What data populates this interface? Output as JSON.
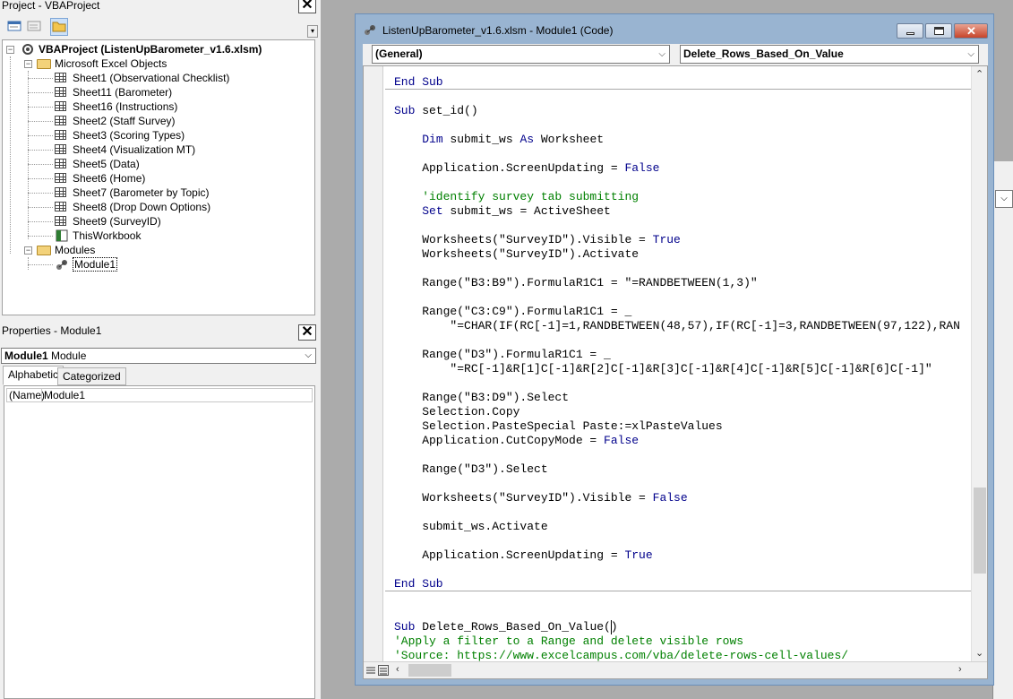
{
  "project_pane": {
    "title": "Project - VBAProject",
    "root": "VBAProject (ListenUpBarometer_v1.6.xlsm)",
    "folder_objects": "Microsoft Excel Objects",
    "sheets": [
      "Sheet1 (Observational Checklist)",
      "Sheet11 (Barometer)",
      "Sheet16 (Instructions)",
      "Sheet2 (Staff Survey)",
      "Sheet3 (Scoring Types)",
      "Sheet4 (Visualization MT)",
      "Sheet5 (Data)",
      "Sheet6 (Home)",
      "Sheet7 (Barometer by Topic)",
      "Sheet8 (Drop Down Options)",
      "Sheet9 (SurveyID)"
    ],
    "this_workbook": "ThisWorkbook",
    "folder_modules": "Modules",
    "module": "Module1"
  },
  "properties_pane": {
    "title": "Properties - Module1",
    "object_name": "Module1",
    "object_type": "Module",
    "tab_alphabetic": "Alphabetic",
    "tab_categorized": "Categorized",
    "prop_name": "(Name)",
    "prop_value": "Module1"
  },
  "code_window": {
    "title": "ListenUpBarometer_v1.6.xlsm - Module1 (Code)",
    "object_combo": "(General)",
    "proc_combo": "Delete_Rows_Based_On_Value",
    "lines": [
      "End Sub",
      "",
      "Sub set_id()",
      "",
      "    Dim submit_ws As Worksheet",
      "",
      "    Application.ScreenUpdating = False",
      "",
      "    'identify survey tab submitting",
      "    Set submit_ws = ActiveSheet",
      "",
      "    Worksheets(\"SurveyID\").Visible = True",
      "    Worksheets(\"SurveyID\").Activate",
      "",
      "    Range(\"B3:B9\").FormulaR1C1 = \"=RANDBETWEEN(1,3)\"",
      "",
      "    Range(\"C3:C9\").FormulaR1C1 = _",
      "        \"=CHAR(IF(RC[-1]=1,RANDBETWEEN(48,57),IF(RC[-1]=3,RANDBETWEEN(97,122),RAN",
      "",
      "    Range(\"D3\").FormulaR1C1 = _",
      "        \"=RC[-1]&R[1]C[-1]&R[2]C[-1]&R[3]C[-1]&R[4]C[-1]&R[5]C[-1]&R[6]C[-1]\"",
      "",
      "    Range(\"B3:D9\").Select",
      "    Selection.Copy",
      "    Selection.PasteSpecial Paste:=xlPasteValues",
      "    Application.CutCopyMode = False",
      "",
      "    Range(\"D3\").Select",
      "",
      "    Worksheets(\"SurveyID\").Visible = False",
      "",
      "    submit_ws.Activate",
      "",
      "    Application.ScreenUpdating = True",
      "",
      "End Sub",
      "",
      "",
      "Sub Delete_Rows_Based_On_Value()",
      "'Apply a filter to a Range and delete visible rows",
      "'Source: https://www.excelcampus.com/vba/delete-rows-cell-values/"
    ]
  },
  "colors": {
    "keyword": "#00008b",
    "comment": "#008000",
    "titlebar": "#99b4d1"
  }
}
